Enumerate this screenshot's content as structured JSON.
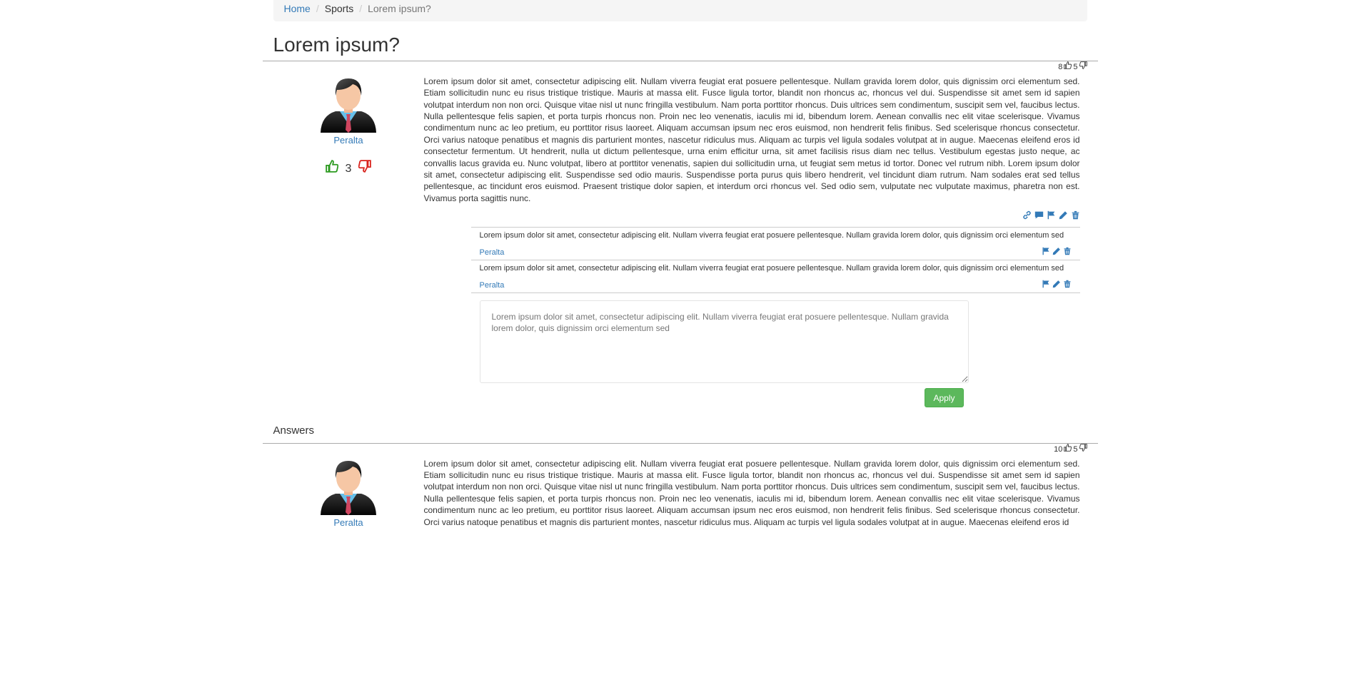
{
  "breadcrumb": {
    "home": "Home",
    "category": "Sports",
    "current": "Lorem ipsum?"
  },
  "question": {
    "title": "Lorem ipsum?",
    "upvotes": "8",
    "downvotes": "5",
    "author": "Peralta",
    "score": "3",
    "body": "Lorem ipsum dolor sit amet, consectetur adipiscing elit. Nullam viverra feugiat erat posuere pellentesque. Nullam gravida lorem dolor, quis dignissim orci elementum sed. Etiam sollicitudin nunc eu risus tristique tristique. Mauris at massa elit. Fusce ligula tortor, blandit non rhoncus ac, rhoncus vel dui. Suspendisse sit amet sem id sapien volutpat interdum non non orci. Quisque vitae nisl ut nunc fringilla vestibulum. Nam porta porttitor rhoncus. Duis ultrices sem condimentum, suscipit sem vel, faucibus lectus. Nulla pellentesque felis sapien, et porta turpis rhoncus non. Proin nec leo venenatis, iaculis mi id, bibendum lorem. Aenean convallis nec elit vitae scelerisque. Vivamus condimentum nunc ac leo pretium, eu porttitor risus laoreet. Aliquam accumsan ipsum nec eros euismod, non hendrerit felis finibus. Sed scelerisque rhoncus consectetur. Orci varius natoque penatibus et magnis dis parturient montes, nascetur ridiculus mus. Aliquam ac turpis vel ligula sodales volutpat at in augue. Maecenas eleifend eros id consectetur fermentum. Ut hendrerit, nulla ut dictum pellentesque, urna enim efficitur urna, sit amet facilisis risus diam nec tellus. Vestibulum egestas justo neque, ac convallis lacus gravida eu. Nunc volutpat, libero at porttitor venenatis, sapien dui sollicitudin urna, ut feugiat sem metus id tortor. Donec vel rutrum nibh. Lorem ipsum dolor sit amet, consectetur adipiscing elit. Suspendisse sed odio mauris. Suspendisse porta purus quis libero hendrerit, vel tincidunt diam rutrum. Nam sodales erat sed tellus pellentesque, ac tincidunt eros euismod. Praesent tristique dolor sapien, et interdum orci rhoncus vel. Sed odio sem, vulputate nec vulputate maximus, pharetra non est. Vivamus porta sagittis nunc.",
    "comments": [
      {
        "text": "Lorem ipsum dolor sit amet, consectetur adipiscing elit. Nullam viverra feugiat erat posuere pellentesque. Nullam gravida lorem dolor, quis dignissim orci elementum sed",
        "author": "Peralta"
      },
      {
        "text": "Lorem ipsum dolor sit amet, consectetur adipiscing elit. Nullam viverra feugiat erat posuere pellentesque. Nullam gravida lorem dolor, quis dignissim orci elementum sed",
        "author": "Peralta"
      }
    ]
  },
  "comment_form": {
    "value": "Lorem ipsum dolor sit amet, consectetur adipiscing elit. Nullam viverra feugiat erat posuere pellentesque. Nullam gravida lorem dolor, quis dignissim orci elementum sed",
    "apply_label": "Apply"
  },
  "answers": {
    "title": "Answers",
    "first": {
      "upvotes": "10",
      "downvotes": "5",
      "author": "Peralta",
      "body": "Lorem ipsum dolor sit amet, consectetur adipiscing elit. Nullam viverra feugiat erat posuere pellentesque. Nullam gravida lorem dolor, quis dignissim orci elementum sed. Etiam sollicitudin nunc eu risus tristique tristique. Mauris at massa elit. Fusce ligula tortor, blandit non rhoncus ac, rhoncus vel dui. Suspendisse sit amet sem id sapien volutpat interdum non non orci. Quisque vitae nisl ut nunc fringilla vestibulum. Nam porta porttitor rhoncus. Duis ultrices sem condimentum, suscipit sem vel, faucibus lectus. Nulla pellentesque felis sapien, et porta turpis rhoncus non. Proin nec leo venenatis, iaculis mi id, bibendum lorem. Aenean convallis nec elit vitae scelerisque. Vivamus condimentum nunc ac leo pretium, eu porttitor risus laoreet. Aliquam accumsan ipsum nec eros euismod, non hendrerit felis finibus. Sed scelerisque rhoncus consectetur. Orci varius natoque penatibus et magnis dis parturient montes, nascetur ridiculus mus. Aliquam ac turpis vel ligula sodales volutpat at in augue. Maecenas eleifend eros id"
    }
  },
  "colors": {
    "link": "#337ab7",
    "upvote": "#2b9a1f",
    "downvote": "#d9221c",
    "apply": "#5cb85c"
  },
  "icons": [
    "thumbs-up-icon",
    "thumbs-down-icon",
    "link-icon",
    "comment-icon",
    "flag-icon",
    "pencil-icon",
    "trash-icon"
  ]
}
